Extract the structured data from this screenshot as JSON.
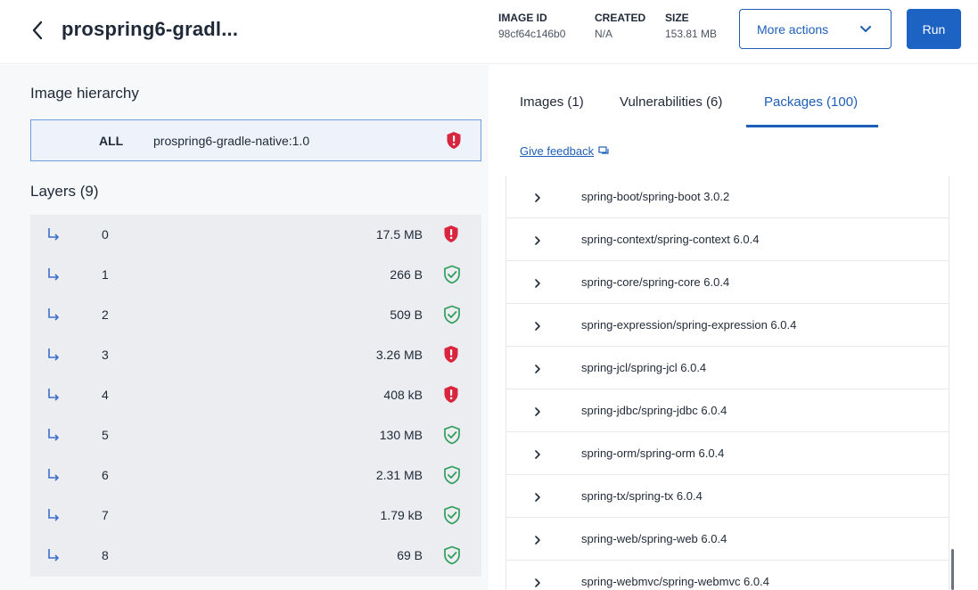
{
  "header": {
    "title": "prospring6-gradl...",
    "image_id_label": "IMAGE ID",
    "image_id_value": "98cf64c146b0",
    "created_label": "CREATED",
    "created_value": "N/A",
    "size_label": "SIZE",
    "size_value": "153.81 MB",
    "more_actions_label": "More actions",
    "run_label": "Run"
  },
  "hierarchy": {
    "title": "Image hierarchy",
    "all_label": "ALL",
    "image_name": "prospring6-gradle-native:1.0",
    "status": "vulnerable"
  },
  "layers": {
    "title": "Layers (9)",
    "items": [
      {
        "index": "0",
        "size": "17.5 MB",
        "status": "vulnerable"
      },
      {
        "index": "1",
        "size": "266 B",
        "status": "ok"
      },
      {
        "index": "2",
        "size": "509 B",
        "status": "ok"
      },
      {
        "index": "3",
        "size": "3.26 MB",
        "status": "vulnerable"
      },
      {
        "index": "4",
        "size": "408 kB",
        "status": "vulnerable"
      },
      {
        "index": "5",
        "size": "130 MB",
        "status": "ok"
      },
      {
        "index": "6",
        "size": "2.31 MB",
        "status": "ok"
      },
      {
        "index": "7",
        "size": "1.79 kB",
        "status": "ok"
      },
      {
        "index": "8",
        "size": "69 B",
        "status": "ok"
      }
    ]
  },
  "tabs": [
    {
      "label": "Images (1)",
      "active": false
    },
    {
      "label": "Vulnerabilities (6)",
      "active": false
    },
    {
      "label": "Packages (100)",
      "active": true
    }
  ],
  "feedback_label": "Give feedback",
  "packages": [
    "spring-boot/spring-boot 3.0.2",
    "spring-context/spring-context 6.0.4",
    "spring-core/spring-core 6.0.4",
    "spring-expression/spring-expression 6.0.4",
    "spring-jcl/spring-jcl 6.0.4",
    "spring-jdbc/spring-jdbc 6.0.4",
    "spring-orm/spring-orm 6.0.4",
    "spring-tx/spring-tx 6.0.4",
    "spring-web/spring-web 6.0.4",
    "spring-webmvc/spring-webmvc 6.0.4"
  ],
  "colors": {
    "accent": "#1d5fb8",
    "danger": "#d7263d",
    "ok": "#2f9e5b"
  },
  "icons": {
    "back": "chevron-left-icon",
    "dropdown": "chevron-down-icon",
    "layer_arrow": "subdirectory-arrow-icon",
    "vulnerable": "shield-alert-icon",
    "ok": "shield-check-icon",
    "expand": "chevron-right-icon",
    "feedback": "chat-icon"
  }
}
